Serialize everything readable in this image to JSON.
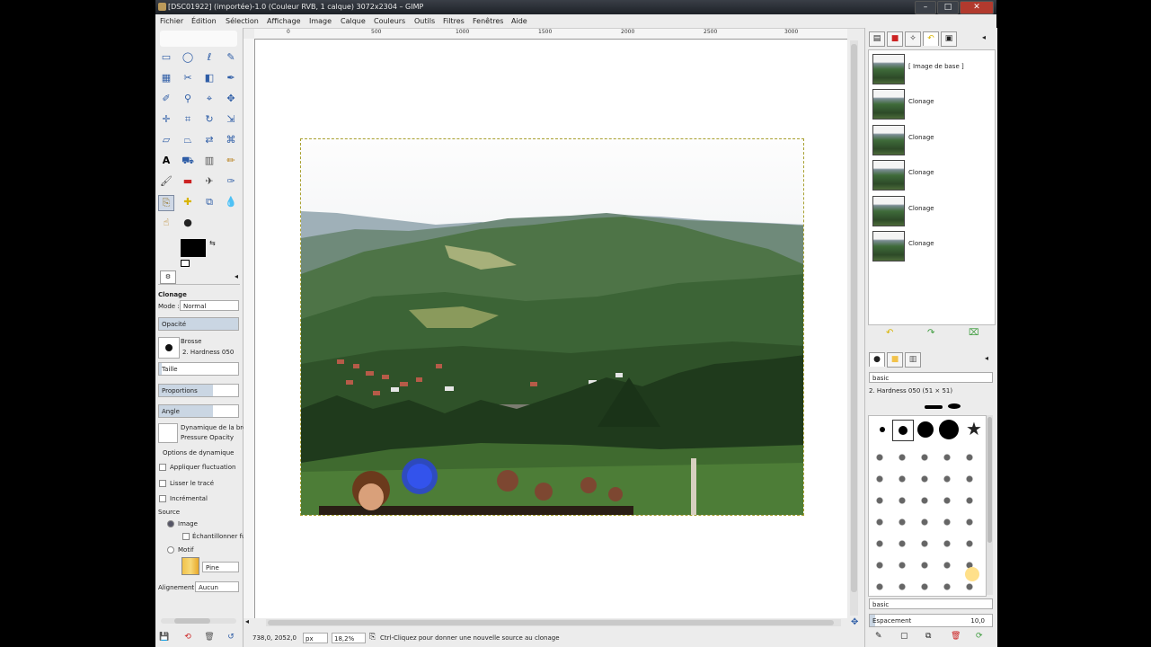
{
  "titlebar": {
    "title": "[DSC01922] (importée)-1.0 (Couleur RVB, 1 calque) 3072x2304 – GIMP",
    "minimize": "–",
    "maximize": "□",
    "close": "✕"
  },
  "menu": [
    "Fichier",
    "Édition",
    "Sélection",
    "Affichage",
    "Image",
    "Calque",
    "Couleurs",
    "Outils",
    "Filtres",
    "Fenêtres",
    "Aide"
  ],
  "tool_options": {
    "title": "Clonage",
    "mode_label": "Mode :",
    "mode_value": "Normal",
    "opacity_label": "Opacité",
    "brush_label": "Brosse",
    "brush_value": "2. Hardness 050",
    "size_label": "Taille",
    "ratio_label": "Proportions",
    "angle_label": "Angle",
    "dynamics_label": "Dynamique de la brosse",
    "dynamics_value": "Pressure Opacity",
    "dynamics_options": "Options de dynamique",
    "apply_jitter": "Appliquer fluctuation",
    "smooth_stroke": "Lisser le tracé",
    "incremental": "Incrémental",
    "source_label": "Source",
    "source_image": "Image",
    "sample_merged": "Échantillonner fusionné",
    "source_pattern": "Motif",
    "pattern_value": "Pine",
    "alignment_label": "Alignement",
    "alignment_value": "Aucun"
  },
  "ruler": {
    "top_labels": [
      "0",
      "500",
      "1000",
      "1500",
      "2000",
      "2500",
      "3000"
    ]
  },
  "status": {
    "coords": "738,0, 2052,0",
    "unit": "px",
    "zoom": "18,2%",
    "message": "Ctrl-Cliquez pour donner une nouvelle source au clonage"
  },
  "history": {
    "items": [
      "[ Image de base ]",
      "Clonage",
      "Clonage",
      "Clonage",
      "Clonage",
      "Clonage"
    ]
  },
  "brushes": {
    "selected": "2. Hardness 050 (51 × 51)",
    "filter_value": "basic",
    "tag_value": "basic",
    "spacing_label": "Espacement",
    "spacing_value": "10,0"
  }
}
